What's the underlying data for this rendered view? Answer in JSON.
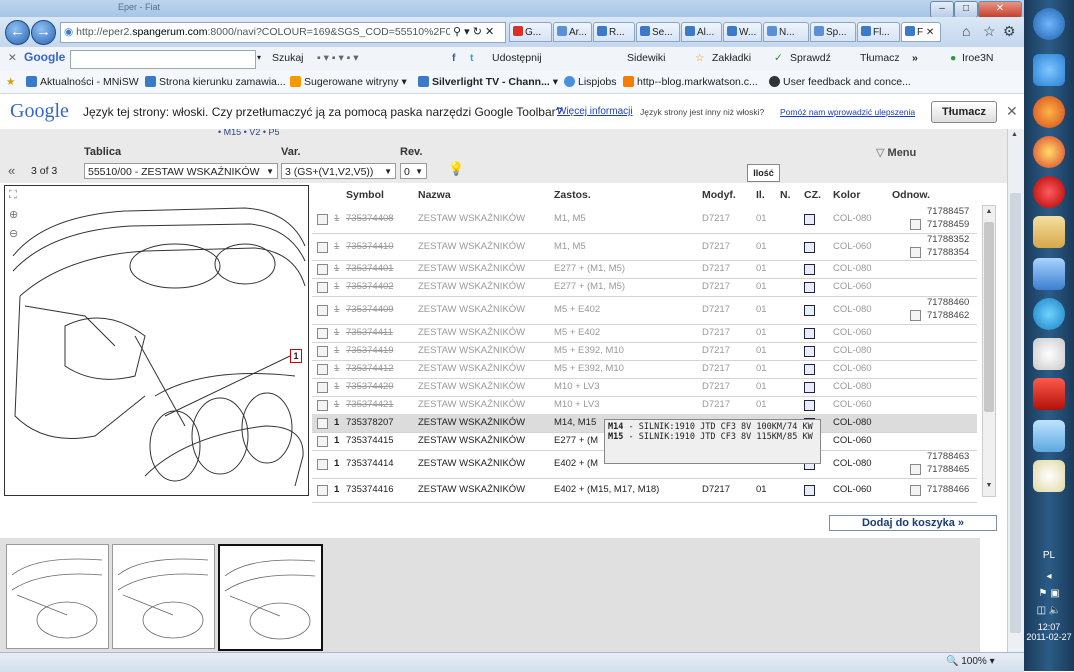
{
  "window": {
    "title": "Eper - Fiat"
  },
  "browser": {
    "url_prefix": "http://eper2.",
    "url_domain": "spangerum.com",
    "url_suffix": ":8000/navi?COLOUR=169&SGS_COD=55510%2F00&V",
    "tabs": [
      {
        "label": "G...",
        "color": "#d93025"
      },
      {
        "label": "Ar...",
        "color": "#5b8fd6"
      },
      {
        "label": "R...",
        "color": "#3a7ac8"
      },
      {
        "label": "Se...",
        "color": "#3a7ac8"
      },
      {
        "label": "Al...",
        "color": "#3a7ac8"
      },
      {
        "label": "W...",
        "color": "#3a7ac8"
      },
      {
        "label": "N...",
        "color": "#5b8fd6"
      },
      {
        "label": "Sp...",
        "color": "#5b8fd6"
      },
      {
        "label": "Fl...",
        "color": "#3a7ac8"
      },
      {
        "label": "F",
        "color": "#3a7ac8",
        "active": true
      }
    ]
  },
  "google_toolbar": {
    "logo": "Google",
    "items": [
      "Szukaj",
      "Udostępnij",
      "Sidewiki",
      "Zakładki",
      "Sprawdź",
      "Tłumacz",
      "Iroe3N"
    ]
  },
  "favorites": [
    "Aktualności - MNiSW",
    "Strona kierunku zamawia...",
    "Sugerowane witryny",
    "Silverlight TV - Chann...",
    "Lispjobs",
    "http--blog.markwatson.c...",
    "User feedback and conce..."
  ],
  "translate_bar": {
    "logo": "Google",
    "message": "Język tej strony: włoski. Czy przetłumaczyć ją za pomocą paska narzędzi Google Toolbar?",
    "more_info": "Więcej informacji",
    "other_lang": "Język strony jest inny niż włoski?",
    "help_improve": "Pomóż nam wprowadzić ulepszenia",
    "translate_button": "Tłumacz"
  },
  "filters": {
    "breadcrumb_fragment": "• M15 • V2 • P5",
    "pager": "3 of 3",
    "tablica_label": "Tablica",
    "tablica_value": "55510/00 - ZESTAW WSKAŹNIKÓW",
    "var_label": "Var.",
    "var_value": "3 (GS+(V1,V2,V5))",
    "rev_label": "Rev.",
    "rev_value": "0",
    "menu": "Menu",
    "tooltip_ilosc": "Ilość"
  },
  "diagram": {
    "callout": "1"
  },
  "grid": {
    "headers": {
      "symbol": "Symbol",
      "nazwa": "Nazwa",
      "zastos": "Zastos.",
      "modyf": "Modyf.",
      "il": "Il.",
      "n": "N.",
      "cz": "CZ.",
      "kolor": "Kolor",
      "odnow": "Odnow."
    },
    "rows": [
      {
        "qty": "1",
        "symbol": "735374408",
        "nazwa": "ZESTAW WSKAŹNIKÓW",
        "zastos": "M1, M5",
        "modyf": "D7217",
        "il": "01",
        "kolor": "COL-080",
        "odnow": [
          "71788457",
          "71788459"
        ],
        "obsolete": true
      },
      {
        "qty": "1",
        "symbol": "735374410",
        "nazwa": "ZESTAW WSKAŹNIKÓW",
        "zastos": "M1, M5",
        "modyf": "D7217",
        "il": "01",
        "kolor": "COL-060",
        "odnow": [
          "71788352",
          "71788354"
        ],
        "obsolete": true
      },
      {
        "qty": "1",
        "symbol": "735374401",
        "nazwa": "ZESTAW WSKAŹNIKÓW",
        "zastos": "E277 + (M1, M5)",
        "modyf": "D7217",
        "il": "01",
        "kolor": "COL-080",
        "odnow": [],
        "obsolete": true
      },
      {
        "qty": "1",
        "symbol": "735374402",
        "nazwa": "ZESTAW WSKAŹNIKÓW",
        "zastos": "E277 + (M1, M5)",
        "modyf": "D7217",
        "il": "01",
        "kolor": "COL-060",
        "odnow": [],
        "obsolete": true
      },
      {
        "qty": "1",
        "symbol": "735374409",
        "nazwa": "ZESTAW WSKAŹNIKÓW",
        "zastos": "M5 + E402",
        "modyf": "D7217",
        "il": "01",
        "kolor": "COL-080",
        "odnow": [
          "71788460",
          "71788462"
        ],
        "obsolete": true
      },
      {
        "qty": "1",
        "symbol": "735374411",
        "nazwa": "ZESTAW WSKAŹNIKÓW",
        "zastos": "M5 + E402",
        "modyf": "D7217",
        "il": "01",
        "kolor": "COL-060",
        "odnow": [],
        "obsolete": true
      },
      {
        "qty": "1",
        "symbol": "735374419",
        "nazwa": "ZESTAW WSKAŹNIKÓW",
        "zastos": "M5 + E392, M10",
        "modyf": "D7217",
        "il": "01",
        "kolor": "COL-080",
        "odnow": [],
        "obsolete": true
      },
      {
        "qty": "1",
        "symbol": "735374412",
        "nazwa": "ZESTAW WSKAŹNIKÓW",
        "zastos": "M5 + E392, M10",
        "modyf": "D7217",
        "il": "01",
        "kolor": "COL-060",
        "odnow": [],
        "obsolete": true
      },
      {
        "qty": "1",
        "symbol": "735374420",
        "nazwa": "ZESTAW WSKAŹNIKÓW",
        "zastos": "M10 + LV3",
        "modyf": "D7217",
        "il": "01",
        "kolor": "COL-080",
        "odnow": [],
        "obsolete": true
      },
      {
        "qty": "1",
        "symbol": "735374421",
        "nazwa": "ZESTAW WSKAŹNIKÓW",
        "zastos": "M10 + LV3",
        "modyf": "D7217",
        "il": "01",
        "kolor": "COL-060",
        "odnow": [],
        "obsolete": true
      },
      {
        "qty": "1",
        "symbol": "735378207",
        "nazwa": "ZESTAW WSKAŹNIKÓW",
        "zastos": "M14, M15",
        "modyf": "",
        "il": "",
        "kolor": "COL-080",
        "odnow": [],
        "obsolete": false,
        "highlight": true
      },
      {
        "qty": "1",
        "symbol": "735374415",
        "nazwa": "ZESTAW WSKAŹNIKÓW",
        "zastos": "E277 + (M",
        "modyf": "",
        "il": "",
        "kolor": "COL-060",
        "odnow": [],
        "obsolete": false
      },
      {
        "qty": "1",
        "symbol": "735374414",
        "nazwa": "ZESTAW WSKAŹNIKÓW",
        "zastos": "E402 + (M",
        "modyf": "",
        "il": "",
        "kolor": "COL-080",
        "odnow": [
          "71788463",
          "71788465"
        ],
        "obsolete": false
      },
      {
        "qty": "1",
        "symbol": "735374416",
        "nazwa": "ZESTAW WSKAŹNIKÓW",
        "zastos": "E402 + (M15, M17, M18)",
        "modyf": "D7217",
        "il": "01",
        "kolor": "COL-060",
        "odnow": [
          "71788466"
        ],
        "obsolete": false
      }
    ]
  },
  "hover_tooltip": {
    "line1_code": "M14",
    "line1": " - SILNIK:1910 JTD CF3 8V 100KM/74 KW",
    "line2_code": "M15",
    "line2": " - SILNIK:1910 JTD CF3 8V 115KM/85 KW"
  },
  "add_to_cart": "Dodaj do koszyka  »",
  "statusbar": {
    "zoom": "100%"
  },
  "taskbar": {
    "lang": "PL",
    "time": "12:07",
    "date": "2011-02-27"
  }
}
